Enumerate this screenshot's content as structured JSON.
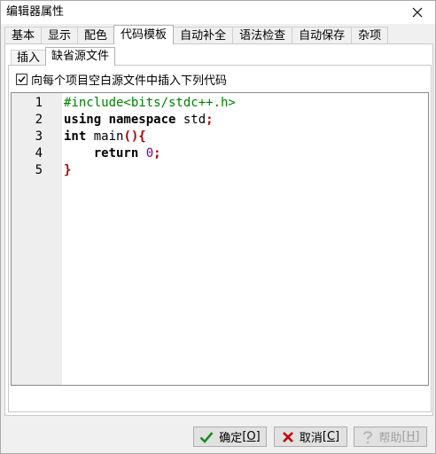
{
  "window": {
    "title": "编辑器属性"
  },
  "tabs": [
    {
      "label": "基本"
    },
    {
      "label": "显示"
    },
    {
      "label": "配色"
    },
    {
      "label": "代码模板"
    },
    {
      "label": "自动补全"
    },
    {
      "label": "语法检查"
    },
    {
      "label": "自动保存"
    },
    {
      "label": "杂项"
    }
  ],
  "subtabs": [
    {
      "label": "插入"
    },
    {
      "label": "缺省源文件"
    }
  ],
  "checkbox": {
    "label": "向每个项目空白源文件中插入下列代码",
    "checked": true
  },
  "editor": {
    "line_numbers": [
      "1",
      "2",
      "3",
      "4",
      "5"
    ],
    "lines": [
      {
        "segments": [
          {
            "text": "#include<bits/stdc++.h>",
            "color": "#008000",
            "bold": false
          }
        ]
      },
      {
        "segments": [
          {
            "text": "using namespace",
            "color": "#000000",
            "bold": true
          },
          {
            "text": " std",
            "color": "#000000",
            "bold": false
          },
          {
            "text": ";",
            "color": "#aa0000",
            "bold": true
          }
        ]
      },
      {
        "segments": [
          {
            "text": "int",
            "color": "#000000",
            "bold": true
          },
          {
            "text": " main",
            "color": "#000000",
            "bold": false
          },
          {
            "text": "(){",
            "color": "#aa0000",
            "bold": true
          }
        ]
      },
      {
        "segments": [
          {
            "text": "    return",
            "color": "#000000",
            "bold": true
          },
          {
            "text": " ",
            "color": "#000000",
            "bold": false
          },
          {
            "text": "0",
            "color": "#800080",
            "bold": false
          },
          {
            "text": ";",
            "color": "#aa0000",
            "bold": true
          }
        ]
      },
      {
        "segments": [
          {
            "text": "}",
            "color": "#aa0000",
            "bold": true
          }
        ]
      }
    ]
  },
  "buttons": {
    "ok": {
      "text": "确定",
      "key": "[O]"
    },
    "cancel": {
      "text": "取消",
      "key": "[C]"
    },
    "help": {
      "text": "帮助",
      "key": "[H]"
    }
  },
  "colors": {
    "ok_icon": "#1a8f1a",
    "cancel_icon": "#c00000"
  }
}
